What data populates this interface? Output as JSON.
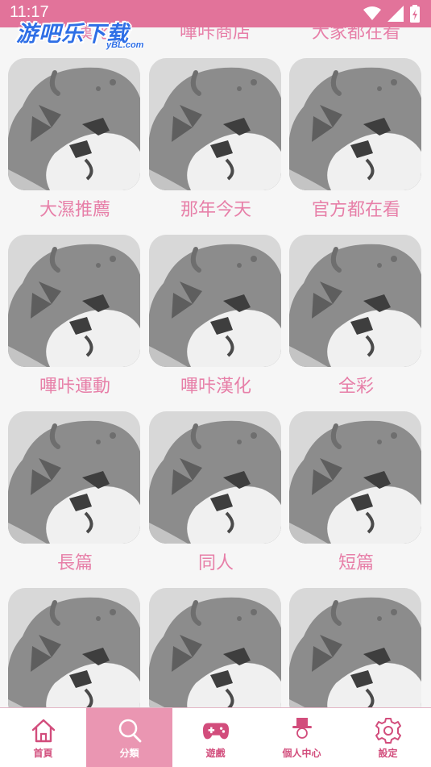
{
  "status_bar": {
    "time": "11:17"
  },
  "watermark": {
    "main": "游吧乐下载",
    "sub": "yBL.com"
  },
  "partial_row": [
    "嗶咔漢化",
    "嗶咔商店",
    "大家都在看"
  ],
  "categories": [
    "大濕推薦",
    "那年今天",
    "官方都在看",
    "嗶咔運動",
    "嗶咔漢化",
    "全彩",
    "長篇",
    "同人",
    "短篇",
    "",
    "",
    ""
  ],
  "bottom_nav": [
    {
      "label": "首頁",
      "icon": "home-icon",
      "active": false
    },
    {
      "label": "分類",
      "icon": "search-icon",
      "active": true
    },
    {
      "label": "遊戲",
      "icon": "gamepad-icon",
      "active": false
    },
    {
      "label": "個人中心",
      "icon": "profile-hat-icon",
      "active": false
    },
    {
      "label": "設定",
      "icon": "gear-icon",
      "active": false
    }
  ],
  "colors": {
    "status_bar": "#e2739a",
    "label_pink": "#e77fa8",
    "nav_active": "#ea96b2",
    "nav_icon": "#d24d7c"
  }
}
